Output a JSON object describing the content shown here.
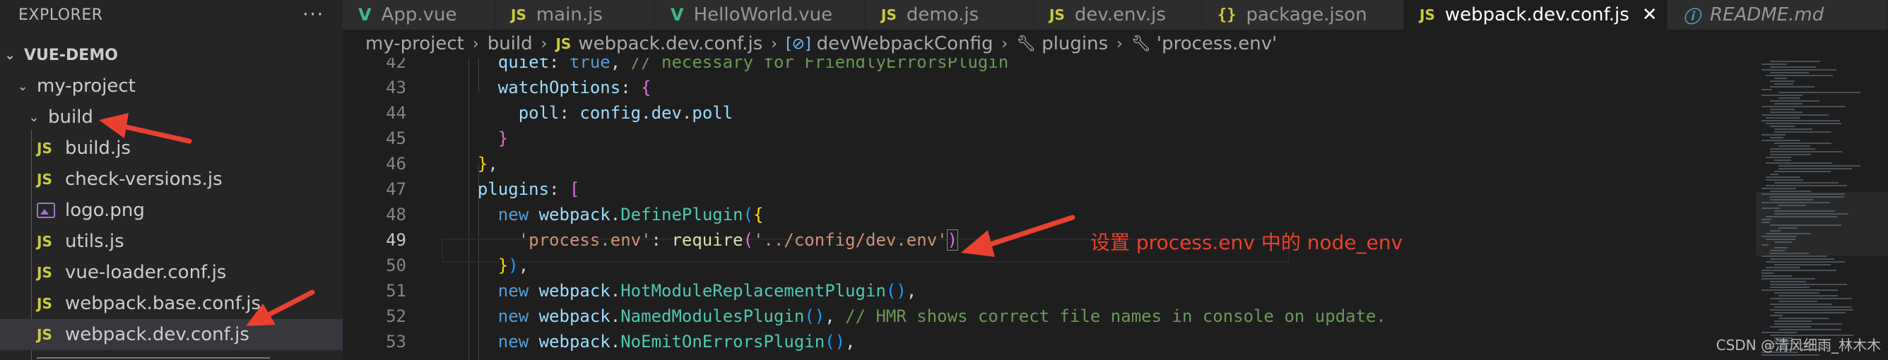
{
  "sidebar": {
    "title": "EXPLORER",
    "more": "···",
    "root": "VUE-DEMO",
    "project": "my-project",
    "folder": "build",
    "files": [
      {
        "label": "build.js",
        "icon": "JS"
      },
      {
        "label": "check-versions.js",
        "icon": "JS"
      },
      {
        "label": "logo.png",
        "icon": "image"
      },
      {
        "label": "utils.js",
        "icon": "JS"
      },
      {
        "label": "vue-loader.conf.js",
        "icon": "JS"
      },
      {
        "label": "webpack.base.conf.js",
        "icon": "JS"
      },
      {
        "label": "webpack.dev.conf.js",
        "icon": "JS"
      }
    ]
  },
  "tabs": [
    {
      "label": "App.vue",
      "icon": "V"
    },
    {
      "label": "main.js",
      "icon": "JS"
    },
    {
      "label": "HelloWorld.vue",
      "icon": "V"
    },
    {
      "label": "demo.js",
      "icon": "JS"
    },
    {
      "label": "dev.env.js",
      "icon": "JS"
    },
    {
      "label": "package.json",
      "icon": "{}"
    },
    {
      "label": "webpack.dev.conf.js",
      "icon": "JS",
      "close": "✕"
    },
    {
      "label": "README.md",
      "icon": "ⓘ"
    }
  ],
  "breadcrumb": {
    "items": [
      "my-project",
      "build",
      "webpack.dev.conf.js",
      "devWebpackConfig",
      "plugins",
      "'process.env'"
    ],
    "js_icon": "JS"
  },
  "editor": {
    "line_numbers": [
      "42",
      "43",
      "44",
      "45",
      "46",
      "47",
      "48",
      "49",
      "50",
      "51",
      "52",
      "53"
    ],
    "current_line": "49"
  },
  "annotation": "设置 process.env 中的 node_env",
  "watermark": "CSDN @清风细雨_林木木",
  "colors": {
    "arrow": "#e8412f",
    "accent": "#007acc"
  }
}
